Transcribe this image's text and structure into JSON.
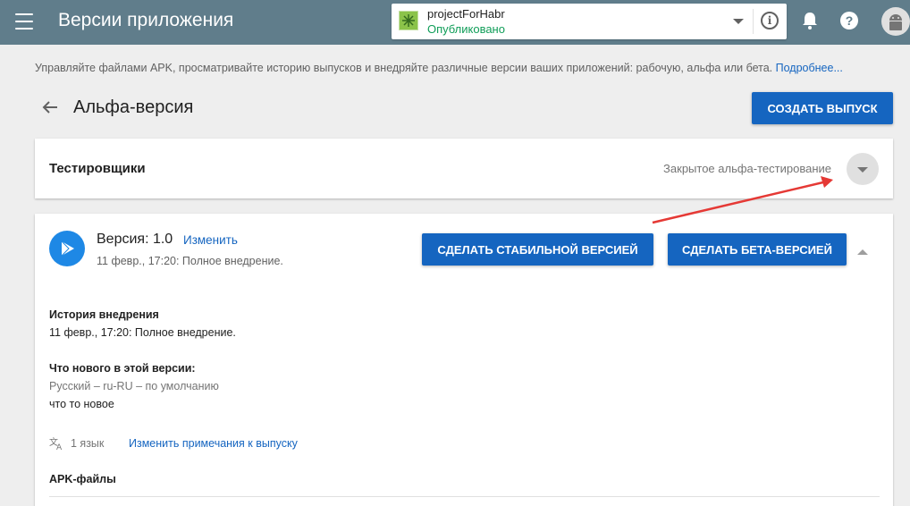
{
  "header": {
    "title": "Версии приложения",
    "app_name": "projectForHabr",
    "app_status": "Опубликовано",
    "help_glyph": "?",
    "info_glyph": "i",
    "colors": {
      "bar": "#607d8b",
      "status": "#0f9d58"
    }
  },
  "description": {
    "text": "Управляйте файлами APK, просматривайте историю выпусков и внедряйте различные версии ваших приложений: рабочую, альфа или бета. ",
    "link": "Подробнее..."
  },
  "page": {
    "title": "Альфа-версия",
    "create_button": "СОЗДАТЬ ВЫПУСК"
  },
  "testers": {
    "title": "Тестировщики",
    "mode": "Закрытое альфа-тестирование"
  },
  "version": {
    "label": "Версия: 1.0",
    "edit_link": "Изменить",
    "subtitle": "11 февр., 17:20: Полное внедрение.",
    "stable_button": "СДЕЛАТЬ СТАБИЛЬНОЙ ВЕРСИЕЙ",
    "beta_button": "СДЕЛАТЬ БЕТА-ВЕРСИЕЙ",
    "rollout_history_title": "История внедрения",
    "rollout_history_text": "11 февр., 17:20: Полное внедрение.",
    "whats_new_title": "Что нового в этой версии:",
    "whats_new_lang": "Русский – ru-RU – по умолчанию",
    "whats_new_text": "что то новое",
    "lang_count": "1 язык",
    "edit_notes_link": "Изменить примечания к выпуску",
    "apk_title": "APK-файлы"
  },
  "accent_colors": {
    "primary": "#1565c0",
    "annotation_arrow": "#e53935"
  }
}
